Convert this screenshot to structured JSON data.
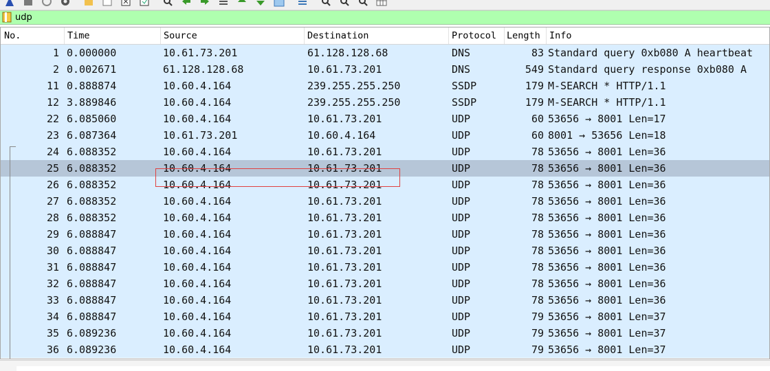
{
  "toolbar": {
    "icons": [
      "shark-fin-icon",
      "stop-icon",
      "restart-icon",
      "options-gear-icon",
      "open-folder-icon",
      "save-icon",
      "close-file-icon",
      "reload-icon",
      "find-icon",
      "go-back-icon",
      "go-forward-icon",
      "go-to-packet-icon",
      "go-first-icon",
      "go-last-icon",
      "autoscroll-icon",
      "colorize-icon",
      "zoom-in-icon",
      "zoom-out-icon",
      "zoom-normal-icon",
      "resize-columns-icon"
    ]
  },
  "filter": {
    "value": "udp"
  },
  "columns": {
    "no": "No.",
    "time": "Time",
    "source": "Source",
    "destination": "Destination",
    "protocol": "Protocol",
    "length": "Length",
    "info": "Info"
  },
  "rows": [
    {
      "no": "1",
      "time": "0.000000",
      "source": "10.61.73.201",
      "destination": "61.128.128.68",
      "protocol": "DNS",
      "length": "83",
      "info": "Standard query 0xb080 A heartbeat"
    },
    {
      "no": "2",
      "time": "0.002671",
      "source": "61.128.128.68",
      "destination": "10.61.73.201",
      "protocol": "DNS",
      "length": "549",
      "info": "Standard query response 0xb080 A"
    },
    {
      "no": "11",
      "time": "0.888874",
      "source": "10.60.4.164",
      "destination": "239.255.255.250",
      "protocol": "SSDP",
      "length": "179",
      "info": "M-SEARCH * HTTP/1.1"
    },
    {
      "no": "12",
      "time": "3.889846",
      "source": "10.60.4.164",
      "destination": "239.255.255.250",
      "protocol": "SSDP",
      "length": "179",
      "info": "M-SEARCH * HTTP/1.1"
    },
    {
      "no": "22",
      "time": "6.085060",
      "source": "10.60.4.164",
      "destination": "10.61.73.201",
      "protocol": "UDP",
      "length": "60",
      "info": "53656 → 8001 Len=17"
    },
    {
      "no": "23",
      "time": "6.087364",
      "source": "10.61.73.201",
      "destination": "10.60.4.164",
      "protocol": "UDP",
      "length": "60",
      "info": "8001 → 53656 Len=18"
    },
    {
      "no": "24",
      "time": "6.088352",
      "source": "10.60.4.164",
      "destination": "10.61.73.201",
      "protocol": "UDP",
      "length": "78",
      "info": "53656 → 8001 Len=36"
    },
    {
      "no": "25",
      "time": "6.088352",
      "source": "10.60.4.164",
      "destination": "10.61.73.201",
      "protocol": "UDP",
      "length": "78",
      "info": "53656 → 8001 Len=36"
    },
    {
      "no": "26",
      "time": "6.088352",
      "source": "10.60.4.164",
      "destination": "10.61.73.201",
      "protocol": "UDP",
      "length": "78",
      "info": "53656 → 8001 Len=36"
    },
    {
      "no": "27",
      "time": "6.088352",
      "source": "10.60.4.164",
      "destination": "10.61.73.201",
      "protocol": "UDP",
      "length": "78",
      "info": "53656 → 8001 Len=36"
    },
    {
      "no": "28",
      "time": "6.088352",
      "source": "10.60.4.164",
      "destination": "10.61.73.201",
      "protocol": "UDP",
      "length": "78",
      "info": "53656 → 8001 Len=36"
    },
    {
      "no": "29",
      "time": "6.088847",
      "source": "10.60.4.164",
      "destination": "10.61.73.201",
      "protocol": "UDP",
      "length": "78",
      "info": "53656 → 8001 Len=36"
    },
    {
      "no": "30",
      "time": "6.088847",
      "source": "10.60.4.164",
      "destination": "10.61.73.201",
      "protocol": "UDP",
      "length": "78",
      "info": "53656 → 8001 Len=36"
    },
    {
      "no": "31",
      "time": "6.088847",
      "source": "10.60.4.164",
      "destination": "10.61.73.201",
      "protocol": "UDP",
      "length": "78",
      "info": "53656 → 8001 Len=36"
    },
    {
      "no": "32",
      "time": "6.088847",
      "source": "10.60.4.164",
      "destination": "10.61.73.201",
      "protocol": "UDP",
      "length": "78",
      "info": "53656 → 8001 Len=36"
    },
    {
      "no": "33",
      "time": "6.088847",
      "source": "10.60.4.164",
      "destination": "10.61.73.201",
      "protocol": "UDP",
      "length": "78",
      "info": "53656 → 8001 Len=36"
    },
    {
      "no": "34",
      "time": "6.088847",
      "source": "10.60.4.164",
      "destination": "10.61.73.201",
      "protocol": "UDP",
      "length": "79",
      "info": "53656 → 8001 Len=37"
    },
    {
      "no": "35",
      "time": "6.089236",
      "source": "10.60.4.164",
      "destination": "10.61.73.201",
      "protocol": "UDP",
      "length": "79",
      "info": "53656 → 8001 Len=37"
    },
    {
      "no": "36",
      "time": "6.089236",
      "source": "10.60.4.164",
      "destination": "10.61.73.201",
      "protocol": "UDP",
      "length": "79",
      "info": "53656 → 8001 Len=37"
    }
  ],
  "selected_row_no": "25",
  "highlighted_row_no": "24",
  "colors": {
    "filter_valid": "#afffaf",
    "row_udp": "#daeeff",
    "row_selected": "#b6c6d8",
    "highlight_box": "#e04040"
  }
}
